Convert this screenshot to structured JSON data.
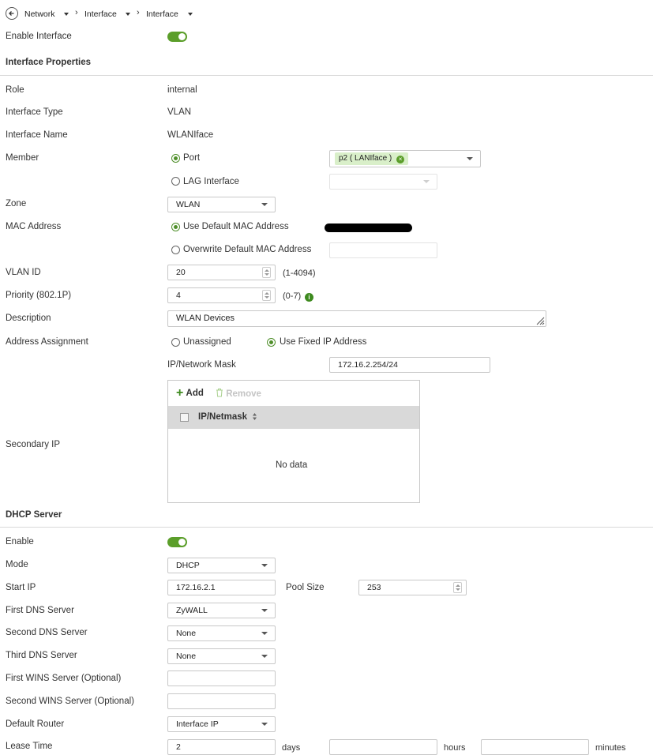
{
  "breadcrumb": {
    "items": [
      {
        "label": "Network"
      },
      {
        "label": "Interface"
      },
      {
        "label": "Interface"
      }
    ]
  },
  "enable_interface": {
    "label": "Enable Interface",
    "on": true
  },
  "interface_properties": {
    "title": "Interface Properties",
    "role": {
      "label": "Role",
      "value": "internal"
    },
    "type": {
      "label": "Interface Type",
      "value": "VLAN"
    },
    "name": {
      "label": "Interface Name",
      "value": "WLANIface"
    },
    "member": {
      "label": "Member",
      "port_option": "Port",
      "port_value": "p2 ( LANIface )",
      "lag_option": "LAG Interface",
      "selected": "Port"
    },
    "zone": {
      "label": "Zone",
      "value": "WLAN"
    },
    "mac": {
      "label": "MAC Address",
      "default_option": "Use Default MAC Address",
      "overwrite_option": "Overwrite Default MAC Address",
      "selected": "default"
    },
    "vlan_id": {
      "label": "VLAN ID",
      "value": "20",
      "range": "(1-4094)"
    },
    "priority": {
      "label": "Priority (802.1P)",
      "value": "4",
      "range": "(0-7)"
    },
    "description": {
      "label": "Description",
      "value": "WLAN Devices"
    },
    "address_assignment": {
      "label": "Address Assignment",
      "unassigned_option": "Unassigned",
      "fixed_option": "Use Fixed IP Address",
      "selected": "fixed"
    },
    "ip_mask": {
      "label": "IP/Network Mask",
      "value": "172.16.2.254/24"
    },
    "secondary_ip": {
      "label": "Secondary IP",
      "add_label": "Add",
      "remove_label": "Remove",
      "column_header": "IP/Netmask",
      "empty_text": "No data"
    }
  },
  "dhcp_server": {
    "title": "DHCP Server",
    "enable": {
      "label": "Enable",
      "on": true
    },
    "mode": {
      "label": "Mode",
      "value": "DHCP"
    },
    "start_ip": {
      "label": "Start IP",
      "value": "172.16.2.1"
    },
    "pool_size": {
      "label": "Pool Size",
      "value": "253"
    },
    "dns1": {
      "label": "First DNS Server",
      "value": "ZyWALL"
    },
    "dns2": {
      "label": "Second DNS Server",
      "value": "None"
    },
    "dns3": {
      "label": "Third DNS Server",
      "value": "None"
    },
    "wins1": {
      "label": "First WINS Server (Optional)",
      "value": ""
    },
    "wins2": {
      "label": "Second WINS Server (Optional)",
      "value": ""
    },
    "default_router": {
      "label": "Default Router",
      "value": "Interface IP"
    },
    "lease_time": {
      "label": "Lease Time",
      "days_value": "2",
      "days_unit": "days",
      "hours_unit": "hours",
      "minutes_unit": "minutes"
    }
  },
  "colors": {
    "accent": "#5b9e2a",
    "tag_bg": "#d9efc9"
  }
}
